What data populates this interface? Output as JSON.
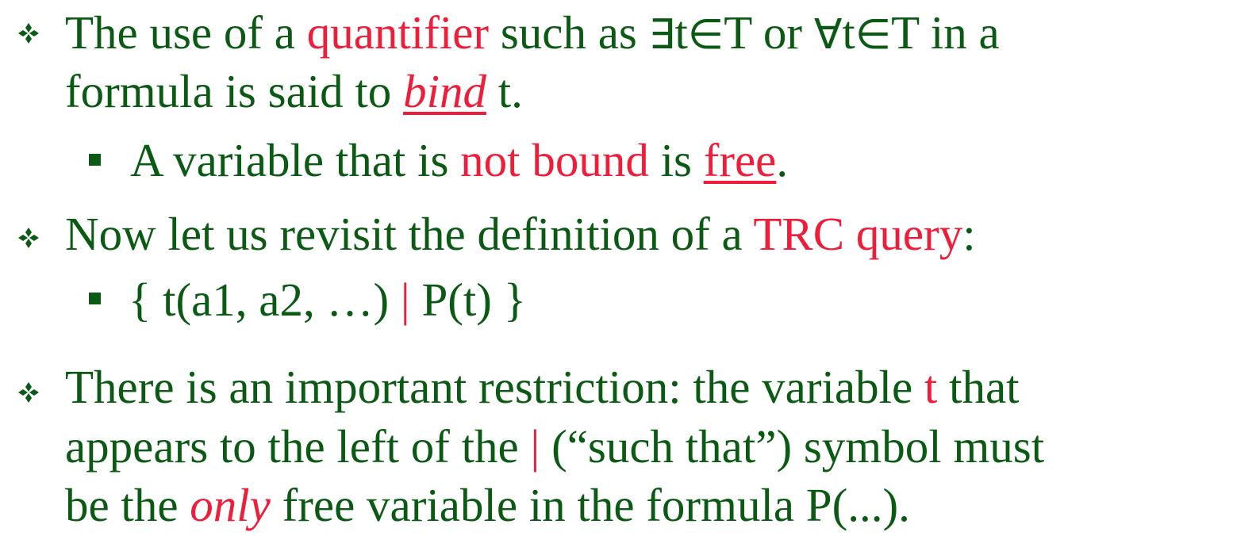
{
  "bullets": [
    {
      "l1": {
        "a": "The use of a ",
        "b": "quantifier",
        "c": " such as ",
        "d1": "∃",
        "d2": "t",
        "d3": "∈",
        "d4": "T",
        "e": " or ",
        "f1": "∀",
        "f2": "t",
        "f3": "∈",
        "f4": "T",
        "g": " in a"
      },
      "l2": {
        "a": "formula is said to ",
        "b": "bind",
        "c": " t."
      },
      "sub": {
        "a": "A variable that is ",
        "b": "not bound",
        "c": " is ",
        "d": "free",
        "e": "."
      }
    },
    {
      "l1": {
        "a": "Now let us revisit the definition of a ",
        "b": "TRC query",
        "c": ":"
      },
      "sub": {
        "a": "{ t(a1, a2, …) ",
        "b": "|",
        "c": " P(t) }"
      }
    },
    {
      "l1": {
        "a": "There is an important restriction:  the variable ",
        "b": "t",
        "c": " that"
      },
      "l2": {
        "a": "appears to the left of the ",
        "b": "|",
        "c": " (“such that”) symbol must"
      },
      "l3": {
        "a": "be the ",
        "b": "only",
        "c": " free variable in the formula P(...)."
      }
    }
  ],
  "icons": {
    "level1": "diamond-star-bullet-icon",
    "level2": "square-bullet-icon"
  },
  "colors": {
    "text": "#0b5a14",
    "highlight": "#ee1d3a",
    "background": "#ffffff"
  }
}
